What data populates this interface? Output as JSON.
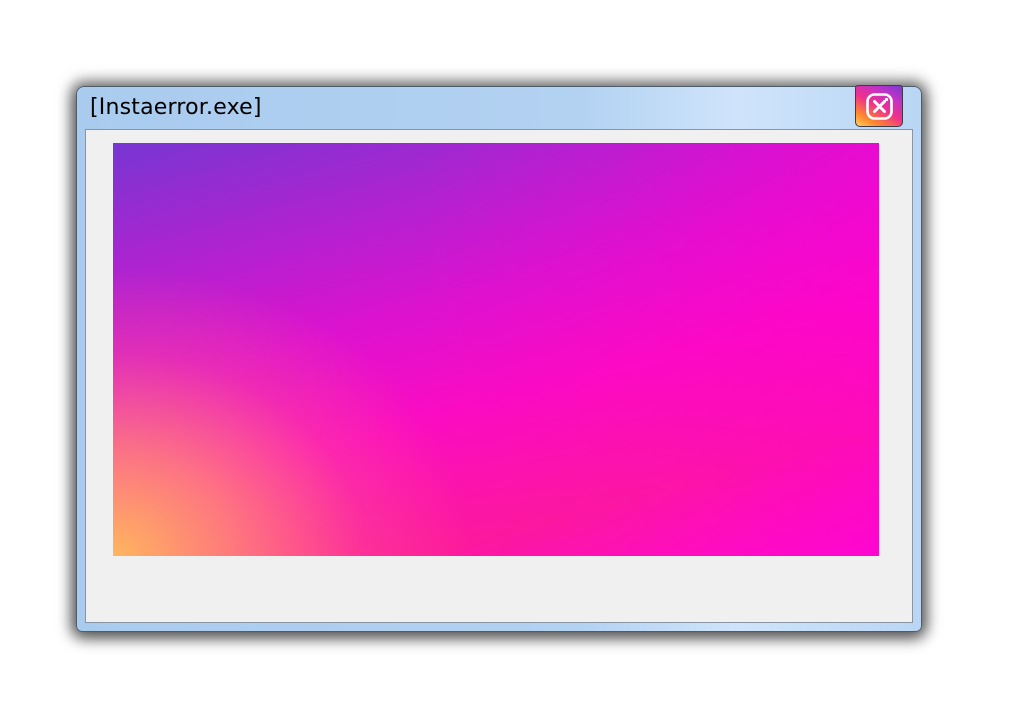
{
  "window": {
    "title": "[Instaerror.exe]",
    "close_icon": "close-icon"
  },
  "colors": {
    "titlebar": "#b3d2f2",
    "client_background": "#f0f0f0",
    "gradient_top_left": "#7836d2",
    "gradient_mid": "#ff05d0",
    "gradient_bottom_left": "#ffb060"
  }
}
